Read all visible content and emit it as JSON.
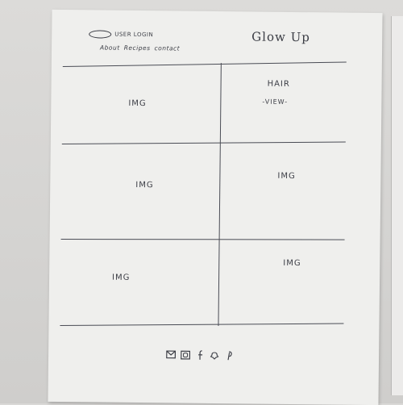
{
  "header": {
    "account_label": "USER LOGIN",
    "brand": "Glow Up",
    "nav": [
      "About",
      "Recipes",
      "contact"
    ]
  },
  "grid": {
    "cells": [
      {
        "label": "IMG"
      },
      {
        "label": "HAIR",
        "link": "-VIEW-"
      },
      {
        "label": "IMG"
      },
      {
        "label": "IMG"
      },
      {
        "label": "IMG"
      },
      {
        "label": "IMG"
      }
    ]
  },
  "footer": {
    "icons": [
      "mail-icon",
      "instagram-icon",
      "facebook-icon",
      "snapchat-icon",
      "pinterest-icon"
    ]
  }
}
